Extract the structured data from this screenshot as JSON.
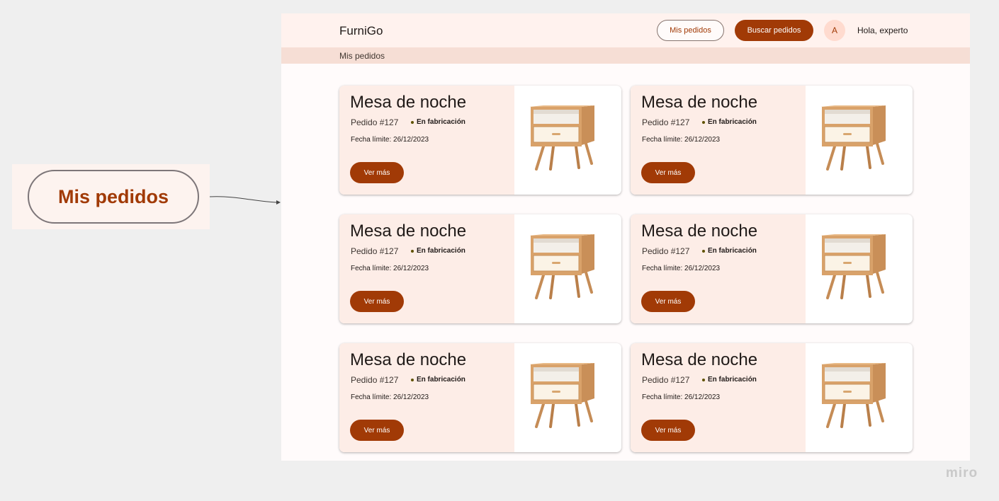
{
  "callout": {
    "label": "Mis pedidos"
  },
  "header": {
    "brand": "FurniGo",
    "nav_my_orders": "Mis pedidos",
    "nav_search_orders": "Buscar pedidos",
    "avatar_initial": "A",
    "greeting": "Hola, experto"
  },
  "breadcrumb": {
    "label": "Mis pedidos"
  },
  "cards": [
    {
      "title": "Mesa de noche",
      "order": "Pedido #127",
      "status": "En fabricación",
      "date": "Fecha límite: 26/12/2023",
      "button": "Ver más"
    },
    {
      "title": "Mesa de noche",
      "order": "Pedido #127",
      "status": "En fabricación",
      "date": "Fecha límite: 26/12/2023",
      "button": "Ver más"
    },
    {
      "title": "Mesa de noche",
      "order": "Pedido #127",
      "status": "En fabricación",
      "date": "Fecha límite: 26/12/2023",
      "button": "Ver más"
    },
    {
      "title": "Mesa de noche",
      "order": "Pedido #127",
      "status": "En fabricación",
      "date": "Fecha límite: 26/12/2023",
      "button": "Ver más"
    },
    {
      "title": "Mesa de noche",
      "order": "Pedido #127",
      "status": "En fabricación",
      "date": "Fecha límite: 26/12/2023",
      "button": "Ver más"
    },
    {
      "title": "Mesa de noche",
      "order": "Pedido #127",
      "status": "En fabricación",
      "date": "Fecha límite: 26/12/2023",
      "button": "Ver más"
    }
  ],
  "watermark": "miro",
  "colors": {
    "primary": "#a13a06",
    "surface": "#fdede7",
    "header_bg": "#fff2ee",
    "breadcrumb_bg": "#f6ded5"
  }
}
